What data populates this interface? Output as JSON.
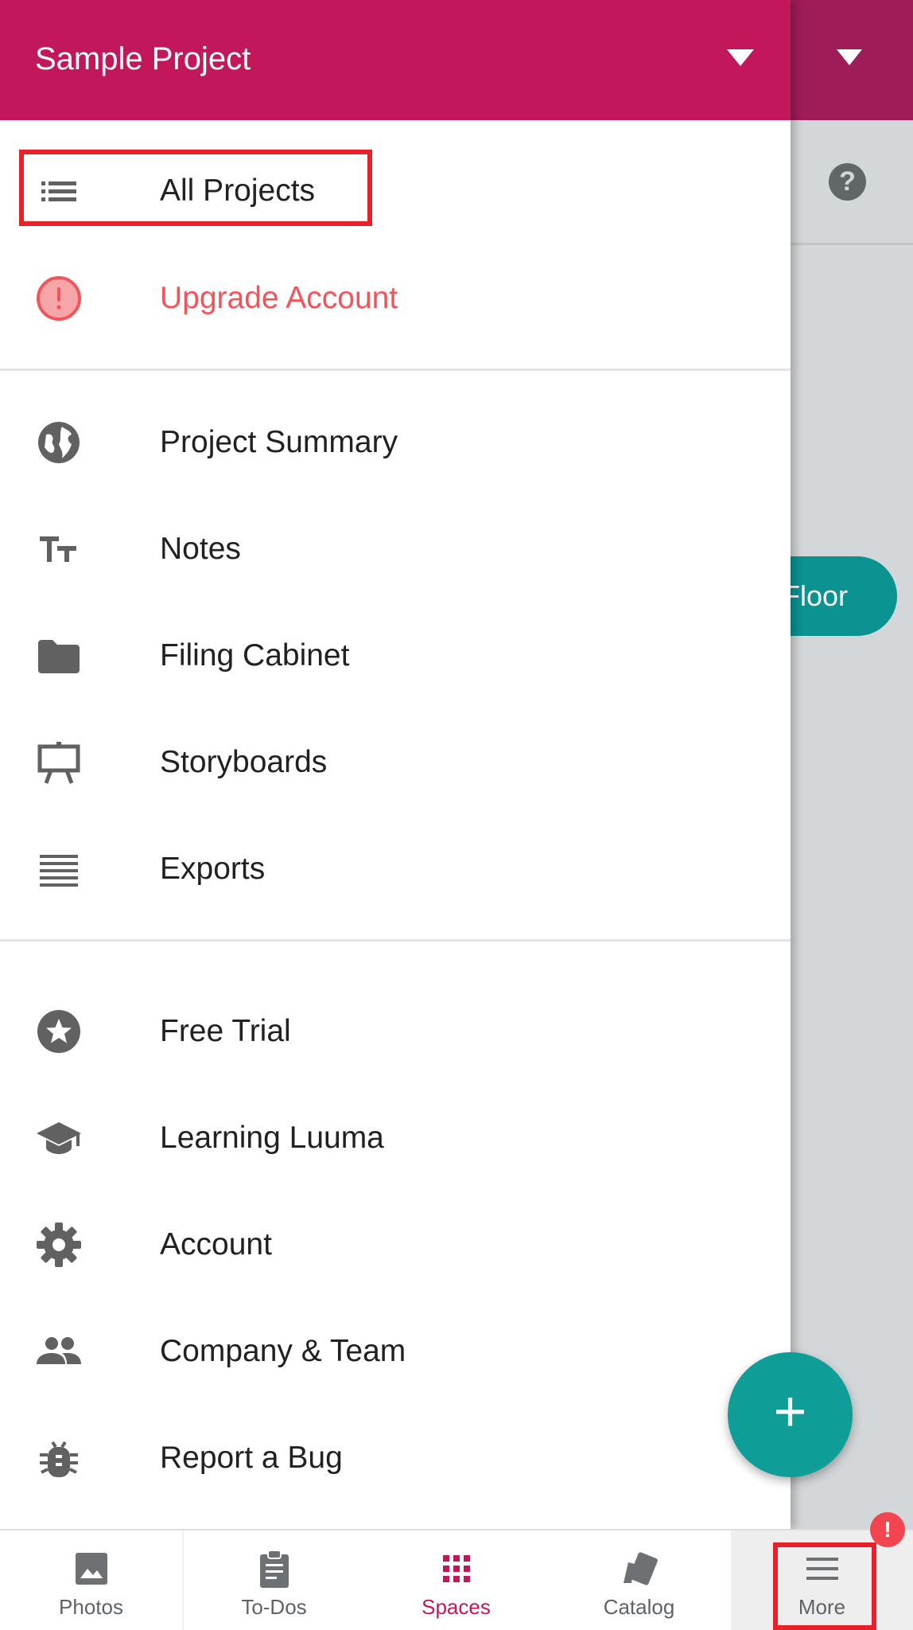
{
  "header": {
    "project_title": "Sample Project",
    "dropdown_icon": "caret-down-icon"
  },
  "background": {
    "help_glyph": "?",
    "floor_button_label": "Floor"
  },
  "drawer": {
    "top_items": [
      {
        "label": "All Projects",
        "icon": "list-icon"
      },
      {
        "label": "Upgrade Account",
        "icon": "alert-circle-icon"
      }
    ],
    "project_items": [
      {
        "label": "Project Summary",
        "icon": "globe-icon"
      },
      {
        "label": "Notes",
        "icon": "text-size-icon"
      },
      {
        "label": "Filing Cabinet",
        "icon": "folder-icon"
      },
      {
        "label": "Storyboards",
        "icon": "easel-icon"
      },
      {
        "label": "Exports",
        "icon": "lines-icon"
      }
    ],
    "app_items": [
      {
        "label": "Free Trial",
        "icon": "star-circle-icon"
      },
      {
        "label": "Learning Luuma",
        "icon": "graduation-cap-icon"
      },
      {
        "label": "Account",
        "icon": "gear-icon"
      },
      {
        "label": "Company & Team",
        "icon": "people-icon"
      },
      {
        "label": "Report a Bug",
        "icon": "bug-icon"
      }
    ]
  },
  "fab": {
    "glyph": "+"
  },
  "bottom_nav": {
    "items": [
      {
        "label": "Photos",
        "icon": "image-icon"
      },
      {
        "label": "To-Dos",
        "icon": "clipboard-icon"
      },
      {
        "label": "Spaces",
        "icon": "grid-icon"
      },
      {
        "label": "Catalog",
        "icon": "swatch-icon"
      },
      {
        "label": "More",
        "icon": "hamburger-icon"
      }
    ],
    "active": "Spaces",
    "more_badge": "!"
  },
  "colors": {
    "brand": "#c2185b",
    "brand_dark": "#9e1c58",
    "teal": "#0e9e97",
    "upgrade_red": "#f2545b",
    "highlight_red": "#e8202a",
    "icon_gray": "#616161"
  }
}
